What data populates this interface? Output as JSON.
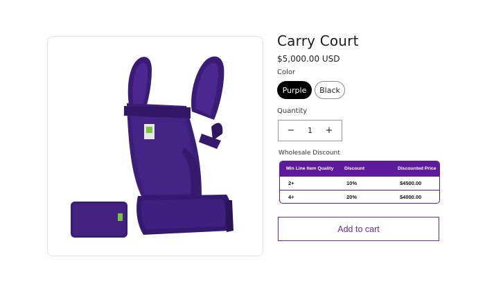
{
  "product": {
    "title": "Carry Court",
    "price": "$5,000.00 USD"
  },
  "color": {
    "label": "Color",
    "options": [
      "Purple",
      "Black"
    ],
    "selected": "Purple"
  },
  "quantity": {
    "label": "Quantity",
    "value": "1",
    "decrement": "−",
    "increment": "+"
  },
  "wholesale": {
    "label": "Wholesale Discount",
    "headers": [
      "Min Line Item Quality",
      "Discount",
      "Discounted Price"
    ],
    "rows": [
      [
        "2+",
        "10%",
        "$4500.00"
      ],
      [
        "4+",
        "20%",
        "$4000.00"
      ]
    ]
  },
  "cart": {
    "button_label": "Add to cart"
  },
  "colors": {
    "accent": "#6b2aa3",
    "table_header": "#5e1a9a",
    "product_purple": "#3d1f78"
  }
}
